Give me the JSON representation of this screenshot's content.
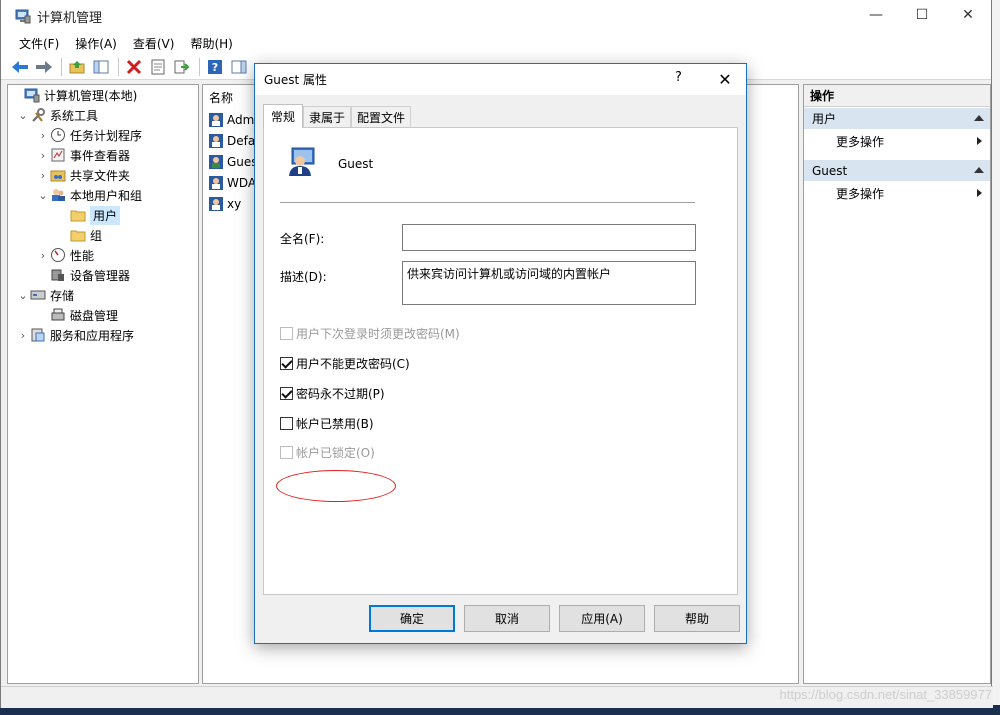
{
  "window": {
    "title": "计算机管理",
    "controls": {
      "minimize": "—",
      "maximize": "☐",
      "close": "✕"
    }
  },
  "menubar": [
    "文件(F)",
    "操作(A)",
    "查看(V)",
    "帮助(H)"
  ],
  "tree": [
    {
      "label": "计算机管理(本地)",
      "icon": "computer-icon"
    },
    {
      "label": "系统工具",
      "icon": "tools-icon"
    },
    {
      "label": "任务计划程序",
      "icon": "clock-icon"
    },
    {
      "label": "事件查看器",
      "icon": "event-icon"
    },
    {
      "label": "共享文件夹",
      "icon": "share-icon"
    },
    {
      "label": "本地用户和组",
      "icon": "users-icon"
    },
    {
      "label": "用户",
      "icon": "folder-icon"
    },
    {
      "label": "组",
      "icon": "folder-icon"
    },
    {
      "label": "性能",
      "icon": "performance-icon"
    },
    {
      "label": "设备管理器",
      "icon": "device-icon"
    },
    {
      "label": "存储",
      "icon": "storage-icon"
    },
    {
      "label": "磁盘管理",
      "icon": "disk-icon"
    },
    {
      "label": "服务和应用程序",
      "icon": "services-icon"
    }
  ],
  "list": {
    "header": "名称",
    "rows": [
      "Admi",
      "Defa",
      "Gues",
      "WDA",
      "xy"
    ]
  },
  "actions": {
    "title": "操作",
    "sections": [
      {
        "label": "用户",
        "item": "更多操作"
      },
      {
        "label": "Guest",
        "item": "更多操作"
      }
    ]
  },
  "watermark": "https://blog.csdn.net/sinat_33859977",
  "dialog": {
    "title": "Guest 属性",
    "help": "?",
    "close": "✕",
    "tabs": [
      "常规",
      "隶属于",
      "配置文件"
    ],
    "username": "Guest",
    "fullname_label": "全名(F):",
    "fullname_value": "",
    "description_label": "描述(D):",
    "description_value": "供来宾访问计算机或访问域的内置帐户",
    "checkboxes": [
      {
        "label": "用户下次登录时须更改密码(M)",
        "checked": false,
        "disabled": true
      },
      {
        "label": "用户不能更改密码(C)",
        "checked": true,
        "disabled": false
      },
      {
        "label": "密码永不过期(P)",
        "checked": true,
        "disabled": false
      },
      {
        "label": "帐户已禁用(B)",
        "checked": false,
        "disabled": false
      },
      {
        "label": "帐户已锁定(O)",
        "checked": false,
        "disabled": true
      }
    ],
    "buttons": {
      "ok": "确定",
      "cancel": "取消",
      "apply": "应用(A)",
      "help": "帮助"
    }
  },
  "colors": {
    "accent": "#0078d7",
    "highlight": "#e02020",
    "section_bg": "#d9e4f1"
  }
}
